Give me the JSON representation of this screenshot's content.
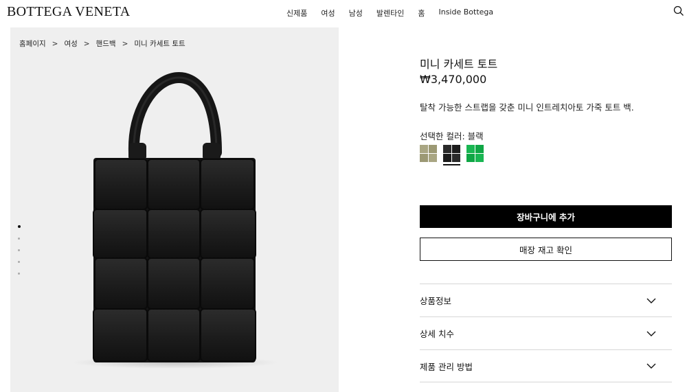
{
  "header": {
    "logo": "BOTTEGA VENETA",
    "nav": [
      "신제품",
      "여성",
      "남성",
      "발렌타인",
      "홈",
      "Inside Bottega"
    ],
    "search_icon": "search-icon"
  },
  "breadcrumb": [
    "홈페이지",
    "여성",
    "핸드백",
    "미니 카세트 토트"
  ],
  "breadcrumb_separator": ">",
  "gallery": {
    "image_count": 5,
    "active_index": 0
  },
  "product": {
    "title": "미니 카세트 토트",
    "price": "₩3,470,000",
    "description": "탈착 가능한 스트랩을 갖춘 미니 인트레치아토 가죽 토트 백.",
    "color_label": "선택한 컬러: 블랙",
    "swatches": [
      {
        "name": "olive",
        "color": "#a3a07a",
        "selected": false
      },
      {
        "name": "black",
        "color": "#222222",
        "selected": true
      },
      {
        "name": "green",
        "color": "#14b04c",
        "selected": false
      }
    ],
    "add_to_cart": "장바구니에 추가",
    "check_store": "매장 재고 확인"
  },
  "accordion": [
    {
      "label": "상품정보"
    },
    {
      "label": "상세 치수"
    },
    {
      "label": "제품 관리 방법"
    }
  ]
}
